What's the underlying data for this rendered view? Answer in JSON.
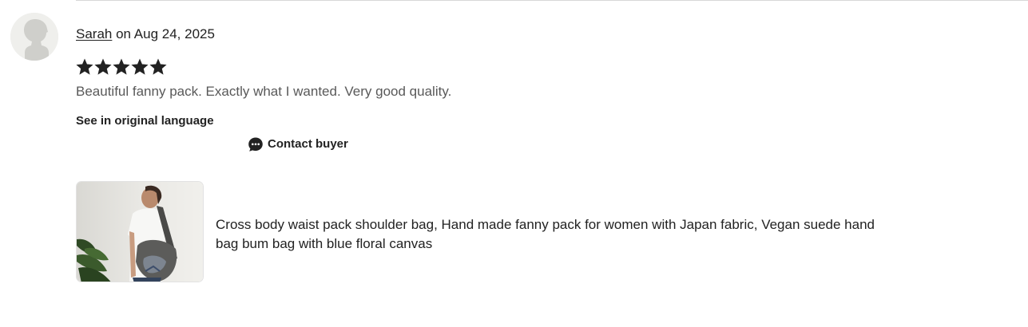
{
  "review": {
    "author": "Sarah",
    "date_text": " on Aug 24, 2025",
    "rating": 5,
    "max_rating": 5,
    "text": "Beautiful fanny pack. Exactly what I wanted. Very good quality.",
    "translate_label": "See in original language",
    "contact_label": "Contact buyer"
  },
  "product": {
    "title": "Cross body waist pack shoulder bag, Hand made fanny pack for women with Japan fabric, Vegan suede hand bag bum bag with blue floral canvas"
  },
  "icons": {
    "avatar": "default-user-avatar-icon",
    "star": "star-icon",
    "contact": "chat-bubble-icon"
  },
  "colors": {
    "text": "#222222",
    "muted_text": "#595959",
    "star": "#222222",
    "divider": "#d7d7d7",
    "avatar_bg": "#efefec"
  }
}
